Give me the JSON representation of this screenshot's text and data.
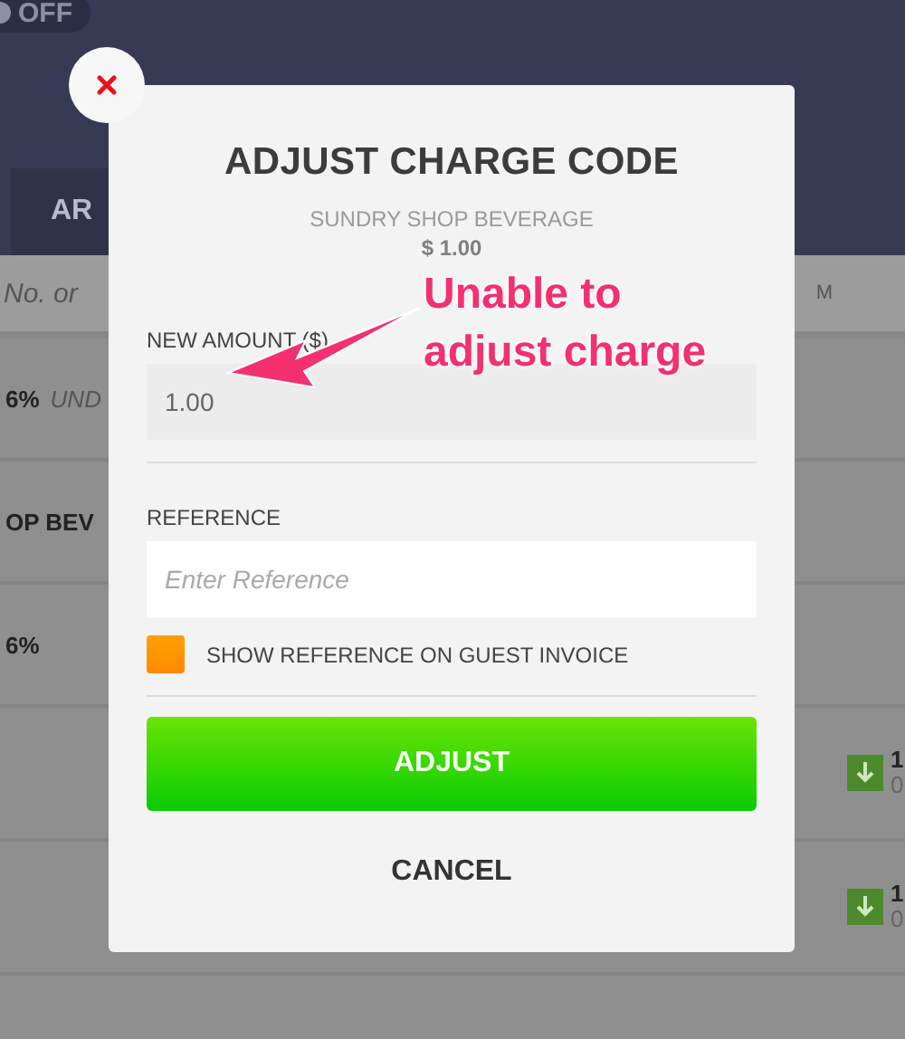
{
  "background": {
    "toggle": {
      "label": "OFF",
      "on": false
    },
    "tabs": [
      {
        "label": "AR"
      }
    ],
    "search": {
      "placeholder": "No. or"
    },
    "column_label": "M",
    "rows": [
      {
        "title": "6%",
        "note": "UND"
      },
      {
        "title": "OP BEV"
      },
      {
        "title": "6%"
      },
      {
        "amount": "1",
        "sub": "0"
      },
      {
        "amount": "1",
        "sub": "0"
      }
    ]
  },
  "modal": {
    "title": "ADJUST CHARGE CODE",
    "item": "SUNDRY SHOP BEVERAGE",
    "price": "$ 1.00",
    "amount_field": {
      "label": "NEW AMOUNT ($)",
      "value": "1.00",
      "disabled": true
    },
    "reference_field": {
      "label": "REFERENCE",
      "placeholder": "Enter Reference"
    },
    "show_on_invoice": {
      "label": "SHOW REFERENCE ON GUEST INVOICE",
      "checked": false
    },
    "buttons": [
      {
        "label": "ADJUST",
        "kind": "primary"
      },
      {
        "label": "CANCEL",
        "kind": "plain"
      }
    ]
  },
  "annotation": {
    "text": "Unable to\nadjust charge"
  }
}
